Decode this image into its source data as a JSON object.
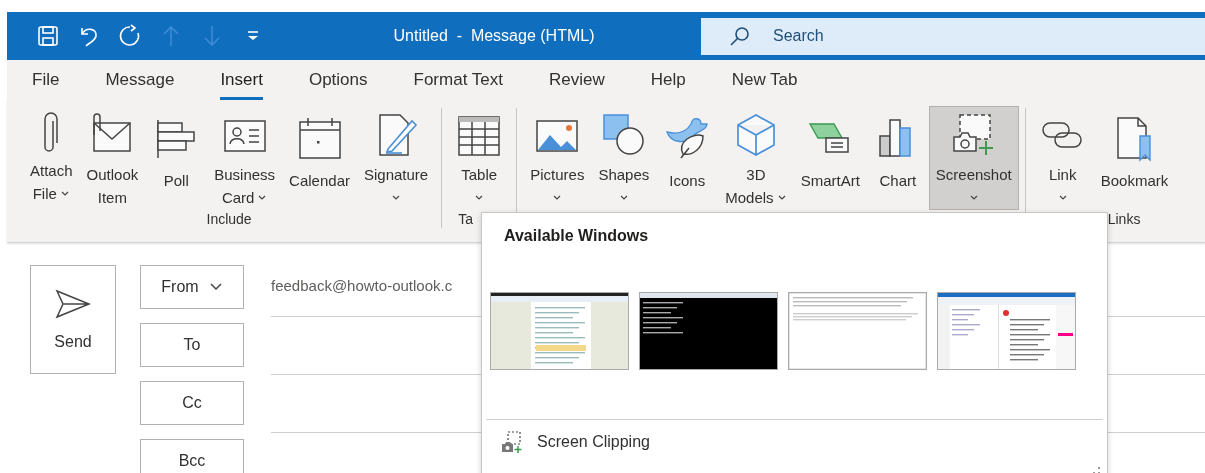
{
  "title_bar": {
    "quick_access": [
      {
        "kind": "save",
        "disabled": false
      },
      {
        "kind": "undo",
        "disabled": false
      },
      {
        "kind": "redo",
        "disabled": false
      },
      {
        "kind": "up",
        "disabled": true
      },
      {
        "kind": "down",
        "disabled": true
      },
      {
        "kind": "customize",
        "disabled": false
      }
    ],
    "title": "Untitled  -  Message (HTML)",
    "search": {
      "placeholder": "Search"
    }
  },
  "tabs": [
    {
      "label": "File",
      "selected": false
    },
    {
      "label": "Message",
      "selected": false
    },
    {
      "label": "Insert",
      "selected": true
    },
    {
      "label": "Options",
      "selected": false
    },
    {
      "label": "Format Text",
      "selected": false
    },
    {
      "label": "Review",
      "selected": false
    },
    {
      "label": "Help",
      "selected": false
    },
    {
      "label": "New Tab",
      "selected": false
    }
  ],
  "ribbon": {
    "groups": [
      {
        "label": "Include",
        "buttons": [
          {
            "kind": "paperclip",
            "lines": [
              "Attach",
              "File"
            ],
            "dropdown": true,
            "pressed": false
          },
          {
            "kind": "envelope",
            "lines": [
              "Outlook",
              "Item"
            ],
            "dropdown": false,
            "pressed": false
          },
          {
            "kind": "poll",
            "lines": [
              "Poll"
            ],
            "dropdown": false,
            "pressed": false
          },
          {
            "kind": "card",
            "lines": [
              "Business",
              "Card"
            ],
            "dropdown": true,
            "pressed": false
          },
          {
            "kind": "calendar",
            "lines": [
              "Calendar"
            ],
            "dropdown": false,
            "pressed": false
          },
          {
            "kind": "signature",
            "lines": [
              "Signature"
            ],
            "dropdown": true,
            "pressed": false
          }
        ]
      },
      {
        "label": "Ta",
        "buttons": [
          {
            "kind": "table",
            "lines": [
              "Table"
            ],
            "dropdown": true,
            "pressed": false
          }
        ]
      },
      {
        "buttons": [
          {
            "kind": "pictures",
            "lines": [
              "Pictures"
            ],
            "dropdown": true,
            "pressed": false
          },
          {
            "kind": "shapes",
            "lines": [
              "Shapes"
            ],
            "dropdown": true,
            "pressed": false
          },
          {
            "kind": "icons",
            "lines": [
              "Icons"
            ],
            "dropdown": false,
            "pressed": false
          },
          {
            "kind": "cube",
            "lines": [
              "3D",
              "Models"
            ],
            "dropdown": true,
            "pressed": false
          },
          {
            "kind": "smartart",
            "lines": [
              "SmartArt"
            ],
            "dropdown": false,
            "pressed": false
          },
          {
            "kind": "chart",
            "lines": [
              "Chart"
            ],
            "dropdown": false,
            "pressed": false
          },
          {
            "kind": "screenshot",
            "lines": [
              "Screenshot"
            ],
            "dropdown": true,
            "pressed": true
          }
        ]
      },
      {
        "label": "Links",
        "buttons": [
          {
            "kind": "link",
            "lines": [
              "Link"
            ],
            "dropdown": true,
            "pressed": false
          },
          {
            "kind": "bookmark",
            "lines": [
              "Bookmark"
            ],
            "dropdown": false,
            "pressed": false
          }
        ]
      }
    ]
  },
  "compose": {
    "send": {
      "label": "Send"
    },
    "fields": [
      {
        "label": "From",
        "dropdown": true,
        "value": "feedback@howto-outlook.c"
      },
      {
        "label": "To",
        "dropdown": false
      },
      {
        "label": "Cc",
        "dropdown": false
      },
      {
        "label": "Bcc",
        "dropdown": false
      }
    ]
  },
  "screenshot_menu": {
    "heading": "Available Windows",
    "windows": [
      {
        "kind": "browser"
      },
      {
        "kind": "console"
      },
      {
        "kind": "document"
      },
      {
        "kind": "mail"
      }
    ],
    "clip": {
      "label": "Screen Clipping"
    }
  }
}
